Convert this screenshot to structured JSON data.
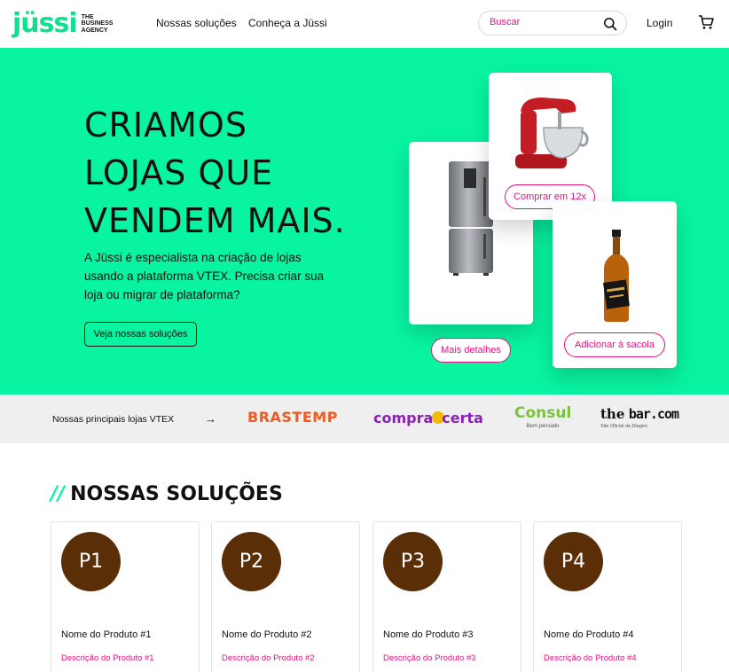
{
  "header": {
    "logo_word": "jüssi",
    "logo_tagline_1": "THE",
    "logo_tagline_2": "BUSINESS",
    "logo_tagline_3": "AGENCY",
    "nav": [
      "Nossas soluções",
      "Conheça a Jüssi"
    ],
    "search_placeholder": "Buscar",
    "login_label": "Login",
    "icons": {
      "search": "search-icon",
      "cart": "cart-icon"
    }
  },
  "hero": {
    "title_line_1": "CRIAMOS",
    "title_line_2": "LOJAS QUE",
    "title_line_3": "VENDEM MAIS.",
    "text": "A Jüssi é especialista na criação de lojas usando a plataforma VTEX. Precisa criar sua loja ou migrar de plataforma?",
    "cta_label": "Veja nossas soluções",
    "cards": [
      {
        "product": "refrigerator",
        "button": "Mais detalhes"
      },
      {
        "product": "stand-mixer",
        "button": "Comprar em 12x"
      },
      {
        "product": "whisky-bottle",
        "button": "Adicionar à sacola"
      }
    ],
    "background_color": "#08f4a0"
  },
  "stores": {
    "label": "Nossas principais lojas VTEX",
    "arrow": "→",
    "logos": [
      {
        "name": "BRASTEMP",
        "color": "#f25a1f"
      },
      {
        "name_part_1": "compra",
        "name_part_2": "certa",
        "color": "#8b1fb8"
      },
      {
        "name": "Consul",
        "tagline": "Bem pensado",
        "color": "#7bc142"
      },
      {
        "name_part_1": "the",
        "name_part_2": "bar.com",
        "tagline": "Site Oficial da Diageo",
        "color": "#111111"
      }
    ]
  },
  "solutions": {
    "slashes": "//",
    "title": "NOSSAS SOLUÇÕES",
    "products": [
      {
        "badge": "P1",
        "name": "Nome do Produto #1",
        "description": "Descrição do Produto #1"
      },
      {
        "badge": "P2",
        "name": "Nome do Produto #2",
        "description": "Descrição do Produto #2"
      },
      {
        "badge": "P3",
        "name": "Nome do Produto #3",
        "description": "Descrição do Produto #3"
      },
      {
        "badge": "P4",
        "name": "Nome do Produto #4",
        "description": "Descrição do Produto #4"
      }
    ]
  },
  "colors": {
    "accent_green": "#08f4a0",
    "accent_pink": "#e0147e",
    "badge_brown": "#5a2e07"
  }
}
